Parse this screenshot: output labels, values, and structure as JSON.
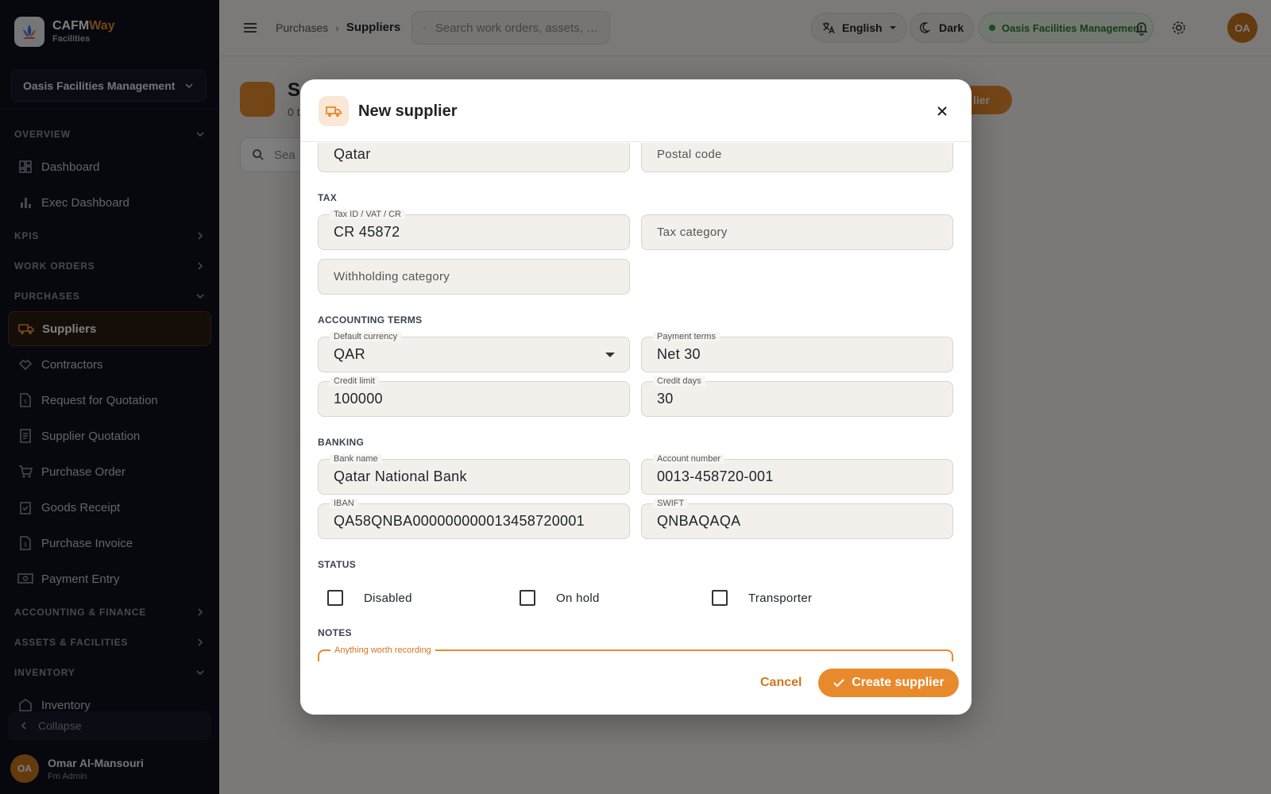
{
  "brand": {
    "name_main": "CAFM",
    "name_accent": "Way",
    "sub": "Facilities"
  },
  "sidebar": {
    "org": "Oasis Facilities Management",
    "sections": {
      "overview": "OVERVIEW",
      "kpis": "KPIS",
      "work_orders": "WORK ORDERS",
      "purchases": "PURCHASES",
      "accounting": "ACCOUNTING & FINANCE",
      "assets": "ASSETS & FACILITIES",
      "inventory": "INVENTORY"
    },
    "overview_items": [
      "Dashboard",
      "Exec Dashboard"
    ],
    "purchase_items": [
      "Suppliers",
      "Contractors",
      "Request for Quotation",
      "Supplier Quotation",
      "Purchase Order",
      "Goods Receipt",
      "Purchase Invoice",
      "Payment Entry"
    ],
    "inventory_items": [
      "Inventory"
    ],
    "collapse": "Collapse",
    "user": {
      "initials": "OA",
      "name": "Omar Al-Mansouri",
      "role": "Fm Admin"
    }
  },
  "topbar": {
    "breadcrumb": [
      "Purchases",
      "Suppliers"
    ],
    "search_placeholder": "Search work orders, assets, …",
    "language": "English",
    "theme": "Dark",
    "org_badge": "Oasis Facilities Management",
    "user_initials": "OA"
  },
  "page": {
    "title_fragment": "S",
    "sub_fragment": "0 t",
    "search_fragment": "Sea",
    "button_fragment": "lier"
  },
  "modal": {
    "title": "New supplier",
    "fields": {
      "country": "Qatar",
      "postal_code_placeholder": "Postal code",
      "tax_id_label": "Tax ID / VAT / CR",
      "tax_id": "CR 45872",
      "tax_category_placeholder": "Tax category",
      "withholding_placeholder": "Withholding category",
      "currency_label": "Default currency",
      "currency": "QAR",
      "payment_terms_label": "Payment terms",
      "payment_terms": "Net 30",
      "credit_limit_label": "Credit limit",
      "credit_limit": "100000",
      "credit_days_label": "Credit days",
      "credit_days": "30",
      "bank_name_label": "Bank name",
      "bank_name": "Qatar National Bank",
      "account_number_label": "Account number",
      "account_number": "0013-458720-001",
      "iban_label": "IBAN",
      "iban": "QA58QNBA000000000013458720001",
      "swift_label": "SWIFT",
      "swift": "QNBAQAQA",
      "notes_label": "Anything worth recording"
    },
    "sections": {
      "tax": "TAX",
      "accounting": "ACCOUNTING TERMS",
      "banking": "BANKING",
      "status": "STATUS",
      "notes": "NOTES"
    },
    "checkboxes": [
      "Disabled",
      "On hold",
      "Transporter"
    ],
    "cancel": "Cancel",
    "create": "Create supplier"
  },
  "colors": {
    "accent": "#e88a2c",
    "sidebar_bg": "#0c111c",
    "success": "#2f9a3b"
  }
}
